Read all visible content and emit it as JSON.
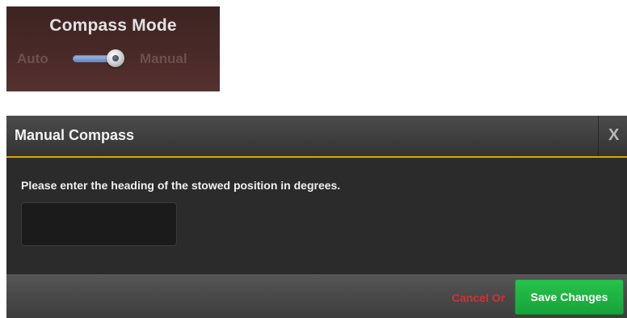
{
  "compass_mode": {
    "title": "Compass Mode",
    "option_left": "Auto",
    "option_right": "Manual",
    "selected": "Manual"
  },
  "dialog": {
    "title": "Manual Compass",
    "close_label": "X",
    "prompt": "Please enter the heading of the stowed position in degrees.",
    "heading_input": {
      "value": "",
      "placeholder": ""
    },
    "cancel_label": "Cancel Or",
    "save_label": "Save Changes"
  },
  "colors": {
    "accent_yellow": "#e0a400",
    "save_green": "#1fb344",
    "cancel_red": "#d62f2f",
    "panel_maroon": "#4a2a28"
  }
}
